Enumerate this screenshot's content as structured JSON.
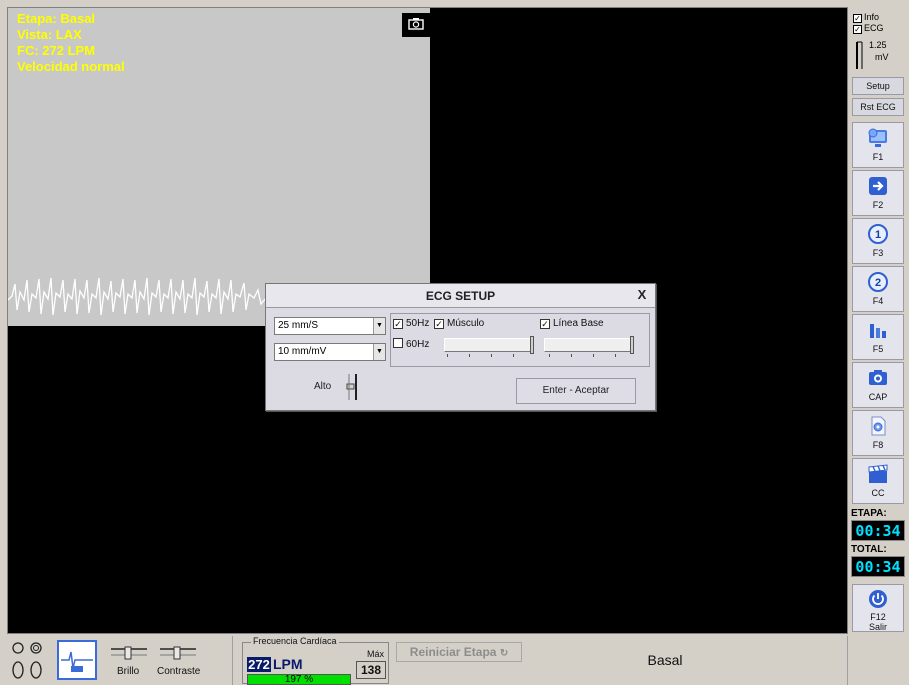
{
  "overlay": {
    "etapa": "Etapa: Basal",
    "vista": "Vista: LAX",
    "fc": "FC: 272 LPM",
    "velocidad": "Velocidad normal"
  },
  "dialog": {
    "title": "ECG SETUP",
    "close": "X",
    "speed_value": "25 mm/S",
    "gain_value": "10 mm/mV",
    "chk_50hz": "50Hz",
    "chk_50hz_checked": true,
    "chk_60hz": "60Hz",
    "chk_60hz_checked": false,
    "chk_musculo": "Músculo",
    "chk_musculo_checked": true,
    "chk_linea_base": "Línea Base",
    "chk_linea_base_checked": true,
    "alto_label": "Alto",
    "accept_label": "Enter - Aceptar"
  },
  "sidebar": {
    "info_label": "Info",
    "info_checked": true,
    "ecg_label": "ECG",
    "ecg_checked": true,
    "scale_value": "1.25",
    "scale_unit": "mV",
    "setup_label": "Setup",
    "rst_ecg_label": "Rst ECG",
    "f_buttons": [
      {
        "label": "F1",
        "icon": "monitor-settings-icon"
      },
      {
        "label": "F2",
        "icon": "arrow-right-icon"
      },
      {
        "label": "F3",
        "icon": "step-one-icon"
      },
      {
        "label": "F4",
        "icon": "step-two-icon"
      },
      {
        "label": "F5",
        "icon": "chart-icon"
      },
      {
        "label": "CAP",
        "icon": "camera-icon"
      },
      {
        "label": "F8",
        "icon": "gear-document-icon"
      },
      {
        "label": "CC",
        "icon": "clapperboard-icon"
      }
    ],
    "etapa_label": "ETAPA:",
    "etapa_time": "00:34",
    "total_label": "TOTAL:",
    "total_time": "00:34",
    "exit_fkey": "F12",
    "exit_label": "Salir"
  },
  "bottom": {
    "brillo_label": "Brillo",
    "contraste_label": "Contraste",
    "freq_title": "Frecuencia Cardíaca",
    "freq_value": "272",
    "freq_unit": "LPM",
    "max_label": "Máx",
    "max_value": "138",
    "pct_text": "197 %",
    "pct_fraction": 1.0,
    "reset_label": "Reiniciar Etapa",
    "stage_name": "Basal"
  },
  "colors": {
    "overlay_text": "#ffff00",
    "timer_text": "#00e0ff",
    "pct_fill": "#00e000",
    "fbutton_icon": "#3a6bd8"
  }
}
